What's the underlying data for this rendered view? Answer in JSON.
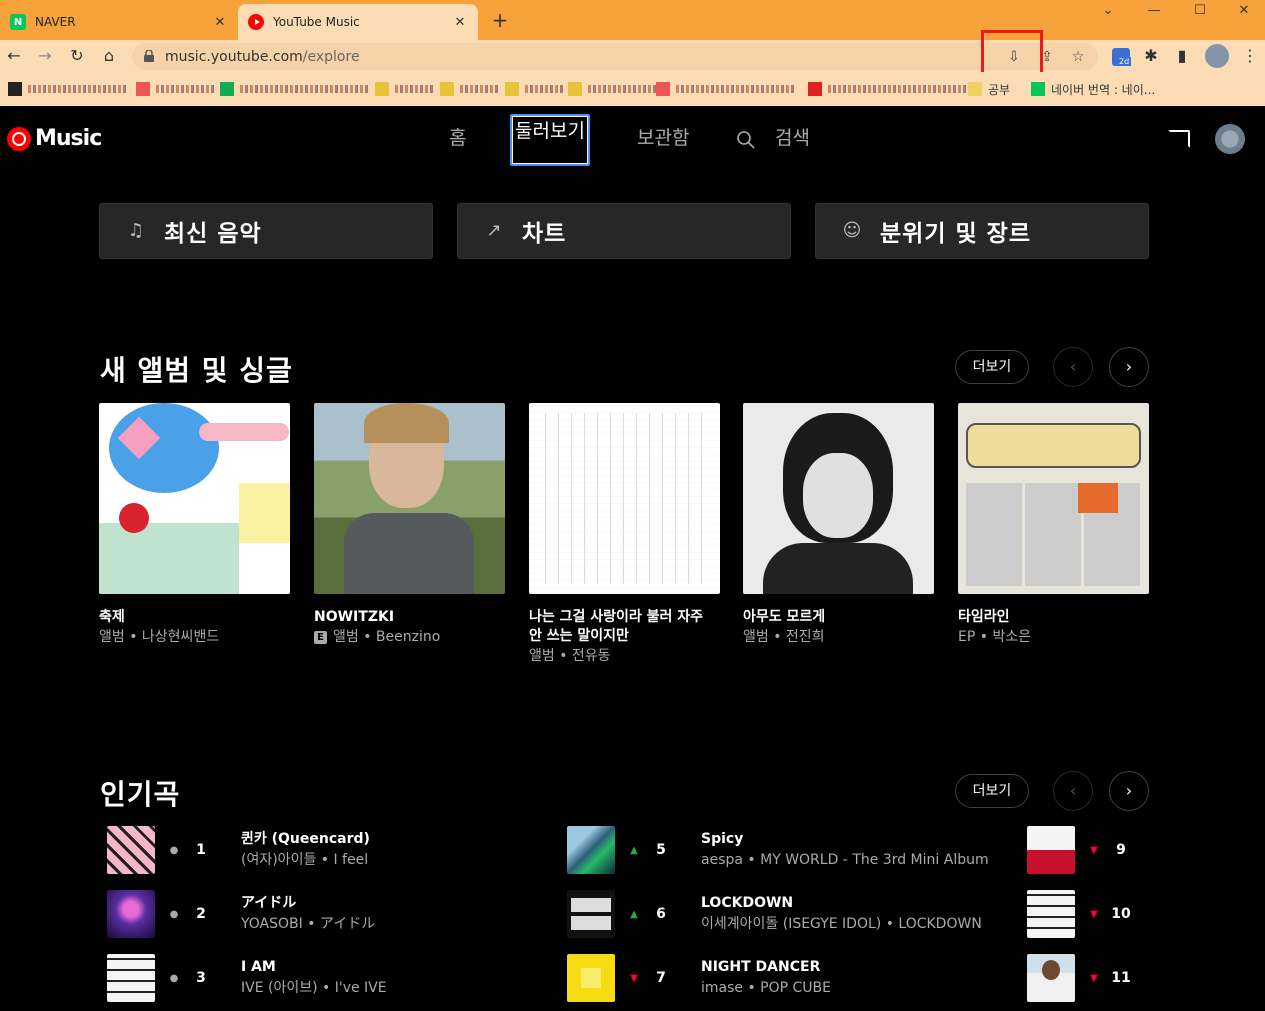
{
  "browser": {
    "tabs": [
      {
        "title": "NAVER",
        "favicon": "naver-icon"
      },
      {
        "title": "YouTube Music",
        "favicon": "youtube-music-icon"
      }
    ],
    "url_host": "music.youtube.com",
    "url_path": "/explore",
    "bookmark_labels": [
      "공부",
      "네이버 번역 : 네이..."
    ],
    "extension_badge": "2d"
  },
  "ytm": {
    "logo_text": "Music",
    "nav": {
      "home": "홈",
      "explore": "둘러보기",
      "library": "보관함",
      "search": "검색"
    },
    "categories": [
      {
        "label": "최신 음악",
        "icon": "new-release-icon"
      },
      {
        "label": "차트",
        "icon": "trending-icon"
      },
      {
        "label": "분위기 및 장르",
        "icon": "smile-icon"
      }
    ],
    "new_releases": {
      "title": "새 앨범 및 싱글",
      "more_label": "더보기",
      "albums": [
        {
          "title": "축제",
          "subtitle": "앨범 • 나상현씨밴드",
          "explicit": false
        },
        {
          "title": "NOWITZKI",
          "subtitle": "앨범 • Beenzino",
          "explicit": true
        },
        {
          "title": "나는 그걸 사랑이라 불러 자주 안 쓰는 말이지만",
          "subtitle": "앨범 • 전유동",
          "explicit": false
        },
        {
          "title": "아무도 모르게",
          "subtitle": "앨범 • 전진희",
          "explicit": false
        },
        {
          "title": "타임라인",
          "subtitle": "EP • 박소은",
          "explicit": false
        }
      ],
      "explicit_badge": "E"
    },
    "popular": {
      "title": "인기곡",
      "more_label": "더보기",
      "songs": [
        {
          "rank": "1",
          "trend": "same",
          "title": "퀸카 (Queencard)",
          "subtitle": "(여자)아이들 • I feel"
        },
        {
          "rank": "2",
          "trend": "same",
          "title": "アイドル",
          "subtitle": "YOASOBI • アイドル"
        },
        {
          "rank": "3",
          "trend": "same",
          "title": "I AM",
          "subtitle": "IVE (아이브) • I've IVE"
        },
        {
          "rank": "5",
          "trend": "up",
          "title": "Spicy",
          "subtitle": "aespa • MY WORLD - The 3rd Mini Album"
        },
        {
          "rank": "6",
          "trend": "up",
          "title": "LOCKDOWN",
          "subtitle": "이세계아이돌 (ISEGYE IDOL) • LOCKDOWN"
        },
        {
          "rank": "7",
          "trend": "down",
          "title": "NIGHT DANCER",
          "subtitle": "imase • POP CUBE"
        },
        {
          "rank": "9",
          "trend": "down",
          "title": "",
          "subtitle": ""
        },
        {
          "rank": "10",
          "trend": "down",
          "title": "",
          "subtitle": ""
        },
        {
          "rank": "11",
          "trend": "down",
          "title": "",
          "subtitle": ""
        }
      ]
    }
  },
  "colors": {
    "accent": "#ff0000",
    "up": "#2ba640",
    "down": "#ff0033",
    "chrome": "#f7a23a"
  }
}
